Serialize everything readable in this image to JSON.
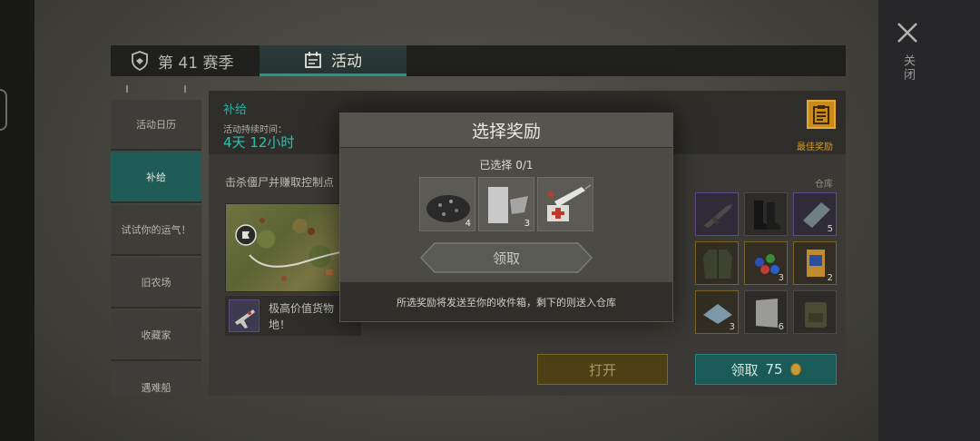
{
  "header": {
    "season_tab": "第 41 赛季",
    "activity_tab": "活动"
  },
  "close": {
    "label": "关闭"
  },
  "sidebar": {
    "items": [
      {
        "label": "活动日历"
      },
      {
        "label": "补给"
      },
      {
        "label": "试试你的运气！"
      },
      {
        "label": "旧农场"
      },
      {
        "label": "收藏家"
      },
      {
        "label": "遇难船"
      }
    ],
    "active_index": 1
  },
  "event": {
    "title": "补给",
    "duration_label": "活动持续时间：",
    "duration_value": "4天 12小时",
    "mission_text": "击杀僵尸并赚取控制点",
    "loot_text": "极高价值货物",
    "loot_text_end": "地！",
    "best_reward_label": "最佳奖励",
    "open_button": "打开"
  },
  "storage": {
    "label": "仓库",
    "items": [
      {
        "icon": "rifle-icon",
        "qty": "",
        "rarity": "purple"
      },
      {
        "icon": "boots-icon",
        "qty": "",
        "rarity": "normal"
      },
      {
        "icon": "metal-plate-icon",
        "qty": "5",
        "rarity": "purple"
      },
      {
        "icon": "jacket-icon",
        "qty": "",
        "rarity": "gold"
      },
      {
        "icon": "pills-icon",
        "qty": "3",
        "rarity": "gold"
      },
      {
        "icon": "seed-packet-icon",
        "qty": "2",
        "rarity": "gold"
      },
      {
        "icon": "cloth-icon",
        "qty": "3",
        "rarity": "gold"
      },
      {
        "icon": "steel-sheet-icon",
        "qty": "6",
        "rarity": "normal"
      },
      {
        "icon": "backpack-icon",
        "qty": "",
        "rarity": "normal"
      }
    ],
    "claim_button": "领取",
    "claim_cost": "75"
  },
  "modal": {
    "title": "选择奖励",
    "selected_count": "已选择 0/1",
    "rewards": [
      {
        "icon": "ore-pile-icon",
        "qty": "4"
      },
      {
        "icon": "aluminum-foil-icon",
        "qty": "3"
      },
      {
        "icon": "syringe-icon",
        "qty": ""
      }
    ],
    "receive_button": "领取",
    "footer_text": "所选奖励将发送至你的收件箱，剩下的则送入仓库"
  }
}
